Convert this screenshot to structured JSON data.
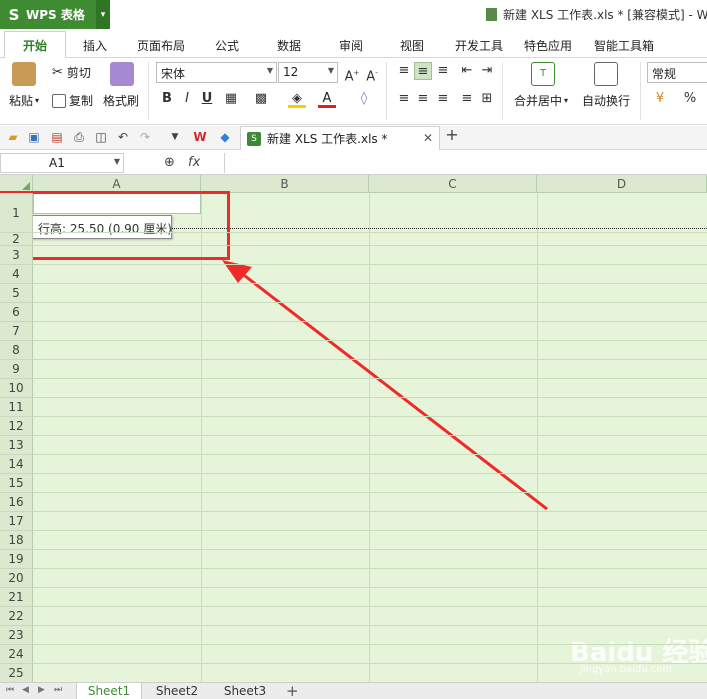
{
  "app": {
    "name": "WPS 表格",
    "logo": "S"
  },
  "window": {
    "title": "新建 XLS 工作表.xls * [兼容模式] - W"
  },
  "ribbon_tabs": [
    "开始",
    "插入",
    "页面布局",
    "公式",
    "数据",
    "审阅",
    "视图",
    "开发工具",
    "特色应用",
    "智能工具箱"
  ],
  "ribbon": {
    "paste": "粘贴",
    "cut": "剪切",
    "copy": "复制",
    "format_painter": "格式刷",
    "font_name": "宋体",
    "font_size": "12",
    "bold": "B",
    "italic": "I",
    "underline": "U",
    "merge_center": "合并居中",
    "wrap_text": "自动换行",
    "number_format": "常规",
    "percent": "%"
  },
  "doc_tab": {
    "label": "新建 XLS 工作表.xls *"
  },
  "formula_bar": {
    "name_box": "A1",
    "fx": "fx"
  },
  "columns": [
    "A",
    "B",
    "C",
    "D"
  ],
  "rows": [
    "1",
    "2",
    "3",
    "4",
    "5",
    "6",
    "7",
    "8",
    "9",
    "10",
    "11",
    "12",
    "13",
    "14",
    "15",
    "16",
    "17",
    "18",
    "19",
    "20",
    "21",
    "22",
    "23",
    "24",
    "25"
  ],
  "tooltip": "行高: 25.50 (0.90 厘米)",
  "sheets": [
    "Sheet1",
    "Sheet2",
    "Sheet3"
  ],
  "watermark": {
    "text": "Baidu 经验",
    "sub": "jingyan.baidu.com"
  },
  "colors": {
    "accent": "#3e8b31",
    "grid_bg": "#e6f4da",
    "annotation": "#ee2a2a"
  }
}
